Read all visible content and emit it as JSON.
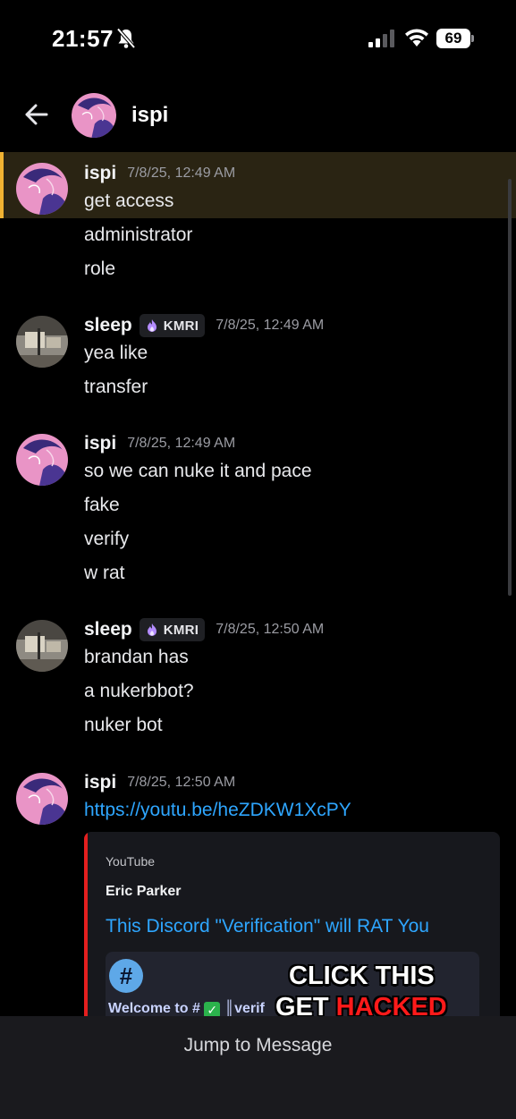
{
  "status_bar": {
    "time": "21:57",
    "battery": "69"
  },
  "header": {
    "title": "ispi"
  },
  "messages": [
    {
      "author": "ispi",
      "tag": "",
      "timestamp": "7/8/25, 12:49 AM",
      "lines": [
        "get access",
        "administrator",
        "role"
      ]
    },
    {
      "author": "sleep",
      "tag": "KMRI",
      "timestamp": "7/8/25, 12:49 AM",
      "lines": [
        "yea like",
        "transfer"
      ]
    },
    {
      "author": "ispi",
      "tag": "",
      "timestamp": "7/8/25, 12:49 AM",
      "lines": [
        "so we can nuke it and pace",
        "fake",
        "verify",
        "w rat"
      ]
    },
    {
      "author": "sleep",
      "tag": "KMRI",
      "timestamp": "7/8/25, 12:50 AM",
      "lines": [
        "brandan has",
        "a nukerbbot?",
        "nuker bot"
      ]
    },
    {
      "author": "ispi",
      "tag": "",
      "timestamp": "7/8/25, 12:50 AM",
      "lines": [
        "https://youtu.be/heZDKW1XcPY"
      ]
    }
  ],
  "embed": {
    "provider": "YouTube",
    "author": "Eric Parker",
    "title": "This Discord \"Verification\" will RAT You",
    "thumbnail": {
      "hash": "#",
      "welcome": "Welcome to #",
      "channel": "║verif",
      "headline_1": "CLICK THIS",
      "headline_2a": "GET ",
      "headline_2b": "HACKED"
    }
  },
  "bottom_bar": {
    "jump_label": "Jump to Message"
  },
  "colors": {
    "background": "#000000",
    "link": "#2ea6ff",
    "highlight_bar": "#f0b232",
    "embed_bar": "#e41f1f"
  }
}
